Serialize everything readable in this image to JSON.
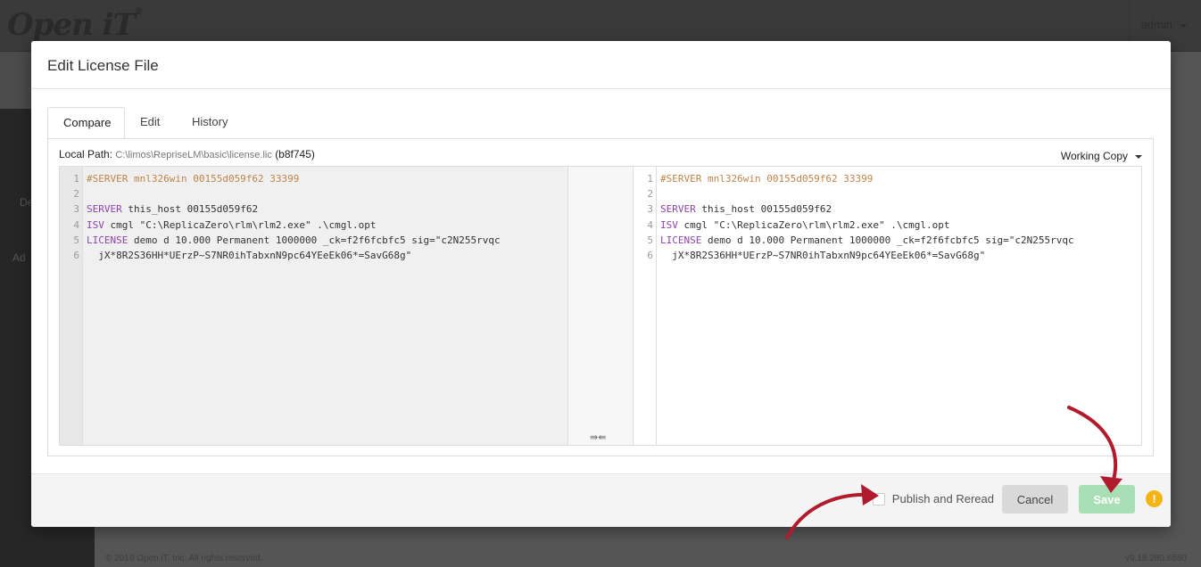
{
  "app": {
    "logo": "Open iT",
    "user_menu": "admin",
    "sidebar_items": [
      "De",
      "Ad"
    ],
    "footer_copyright": "© 2019 Open iT, Inc. All rights reserved.",
    "footer_version": "v9.18.280.6580"
  },
  "modal": {
    "title": "Edit License File",
    "tabs": [
      {
        "label": "Compare",
        "active": true
      },
      {
        "label": "Edit",
        "active": false
      },
      {
        "label": "History",
        "active": false
      }
    ],
    "local_path_label": "Local Path:",
    "local_path_value": "C:\\limos\\RepriseLM\\basic\\license.lic",
    "local_path_hash": "(b8f745)",
    "version_select": "Working Copy",
    "merge_arrows": "⇛⇚",
    "left_lines": [
      {
        "n": "1",
        "parts": [
          [
            "c-comment",
            "#SERVER mnl326win 00155d059f62 33399"
          ]
        ]
      },
      {
        "n": "2",
        "parts": []
      },
      {
        "n": "3",
        "parts": [
          [
            "c-kw",
            "SERVER"
          ],
          [
            "c-str",
            " this_host 00155d059f62"
          ]
        ]
      },
      {
        "n": "4",
        "parts": [
          [
            "c-kw",
            "ISV"
          ],
          [
            "c-str",
            " cmgl \"C:\\ReplicaZero\\rlm\\rlm2.exe\" .\\cmgl.opt"
          ]
        ]
      },
      {
        "n": "5",
        "parts": [
          [
            "c-kw",
            "LICENSE"
          ],
          [
            "c-str",
            " demo d 10.000 Permanent 1000000 _ck=f2f6fcbfc5 sig=\"c2N255rvqc"
          ]
        ]
      },
      {
        "n": "6",
        "parts": [
          [
            "c-str",
            "  jX*8R2S36HH*UErzP~S7NR0ihTabxnN9pc64YEeEk06*=SavG68g\""
          ]
        ]
      }
    ],
    "right_lines": [
      {
        "n": "1",
        "parts": [
          [
            "c-comment",
            "#SERVER mnl326win 00155d059f62 33399"
          ]
        ]
      },
      {
        "n": "2",
        "parts": []
      },
      {
        "n": "3",
        "parts": [
          [
            "c-kw",
            "SERVER"
          ],
          [
            "c-str",
            " this_host 00155d059f62"
          ]
        ]
      },
      {
        "n": "4",
        "parts": [
          [
            "c-kw",
            "ISV"
          ],
          [
            "c-str",
            " cmgl \"C:\\ReplicaZero\\rlm\\rlm2.exe\" .\\cmgl.opt"
          ]
        ]
      },
      {
        "n": "5",
        "parts": [
          [
            "c-kw",
            "LICENSE"
          ],
          [
            "c-str",
            " demo d 10.000 Permanent 1000000 _ck=f2f6fcbfc5 sig=\"c2N255rvqc"
          ]
        ]
      },
      {
        "n": "6",
        "parts": [
          [
            "c-str",
            "  jX*8R2S36HH*UErzP~S7NR0ihTabxnN9pc64YEeEk06*=SavG68g\""
          ]
        ]
      }
    ],
    "footer": {
      "publish_label": "Publish and Reread",
      "cancel_label": "Cancel",
      "save_label": "Save",
      "warning_glyph": "!"
    }
  },
  "colors": {
    "save_button": "#a8dfb4",
    "warning": "#f3b414",
    "annotation_arrow": "#b01c2e"
  }
}
